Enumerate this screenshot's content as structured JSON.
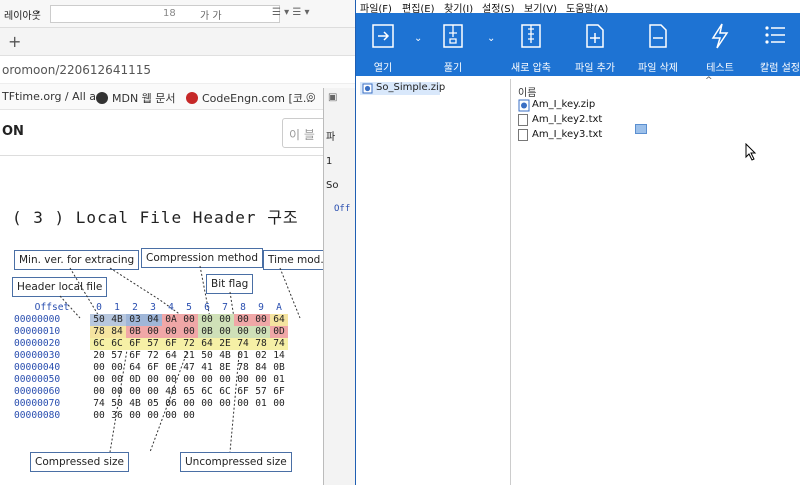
{
  "browser": {
    "toolbar": {
      "layout_label": "레이아웃",
      "font_size": "18"
    },
    "tab_plus": "+",
    "address": "oromoon/220612641115",
    "bookmarks": [
      {
        "label": "TFtime.org / All a..."
      },
      {
        "label": "MDN 웹 문서"
      },
      {
        "label": "CodeEngn.com [코..."
      }
    ],
    "site_title": "ON",
    "search_placeholder": "이 블",
    "heading": "( 3 ) Local File Header 구조",
    "diagram": {
      "labels": {
        "min_ver": "Min. ver. for extracing",
        "compression": "Compression method",
        "time_mod": "Time mod.",
        "header_local": "Header local file",
        "bit_flag": "Bit flag",
        "compressed_size": "Compressed size",
        "uncompressed_size": "Uncompressed size"
      },
      "header": [
        "Offset",
        "0",
        "1",
        "2",
        "3",
        "4",
        "5",
        "6",
        "7",
        "8",
        "9",
        "A"
      ],
      "rows": [
        {
          "off": "00000000",
          "bytes": [
            "50",
            "4B",
            "03",
            "04",
            "0A",
            "00",
            "00",
            "00",
            "00",
            "00",
            "64"
          ]
        },
        {
          "off": "00000010",
          "bytes": [
            "78",
            "84",
            "0B",
            "00",
            "00",
            "00",
            "0B",
            "00",
            "00",
            "00",
            "0D"
          ]
        },
        {
          "off": "00000020",
          "bytes": [
            "6C",
            "6C",
            "6F",
            "57",
            "6F",
            "72",
            "64",
            "2E",
            "74",
            "78",
            "74"
          ]
        },
        {
          "off": "00000030",
          "bytes": [
            "20",
            "57",
            "6F",
            "72",
            "64",
            "21",
            "50",
            "4B",
            "01",
            "02",
            "14"
          ]
        },
        {
          "off": "00000040",
          "bytes": [
            "00",
            "00",
            "64",
            "6F",
            "0E",
            "47",
            "41",
            "8E",
            "78",
            "84",
            "0B"
          ]
        },
        {
          "off": "00000050",
          "bytes": [
            "00",
            "00",
            "0D",
            "00",
            "00",
            "00",
            "00",
            "00",
            "00",
            "00",
            "01"
          ]
        },
        {
          "off": "00000060",
          "bytes": [
            "00",
            "00",
            "00",
            "00",
            "48",
            "65",
            "6C",
            "6C",
            "6F",
            "57",
            "6F"
          ]
        },
        {
          "off": "00000070",
          "bytes": [
            "74",
            "50",
            "4B",
            "05",
            "06",
            "00",
            "00",
            "00",
            "00",
            "01",
            "00"
          ]
        },
        {
          "off": "00000080",
          "bytes": [
            "00",
            "36",
            "00",
            "00",
            "00",
            "00",
            "",
            "",
            "",
            "",
            ""
          ]
        }
      ]
    }
  },
  "ghost": {
    "items": [
      "파",
      "1",
      "So",
      "Off"
    ]
  },
  "archiver": {
    "menu": [
      "파일(F)",
      "편집(E)",
      "찾기(I)",
      "설정(S)",
      "보기(V)",
      "도움말(A)"
    ],
    "ribbon": [
      {
        "label": "열기",
        "icon": "open-icon"
      },
      {
        "label": "풀기",
        "icon": "extract-icon"
      },
      {
        "label": "새로 압축",
        "icon": "new-archive-icon"
      },
      {
        "label": "파일 추가",
        "icon": "add-file-icon"
      },
      {
        "label": "파일 삭제",
        "icon": "delete-file-icon"
      },
      {
        "label": "테스트",
        "icon": "test-icon"
      },
      {
        "label": "칼럼 설정",
        "icon": "column-settings-icon"
      }
    ],
    "tree_root": "So_Simple.zip",
    "column_name": "이름",
    "files": [
      {
        "name": "Am_I_key.zip",
        "type": "zip"
      },
      {
        "name": "Am_I_key2.txt",
        "type": "txt"
      },
      {
        "name": "Am_I_key3.txt",
        "type": "txt"
      }
    ],
    "colors": {
      "ribbon": "#1e73d3",
      "selection": "#d9e8fb"
    }
  }
}
